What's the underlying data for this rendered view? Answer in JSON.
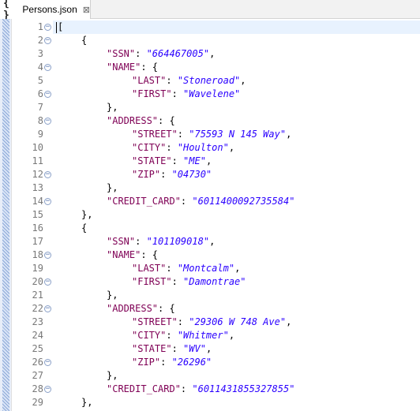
{
  "tab": {
    "icon": "json-braces-icon",
    "title": "Persons.json",
    "close": "⊠"
  },
  "editor": {
    "lines": [
      {
        "n": "1",
        "fold": true,
        "indent": 0,
        "text": "["
      },
      {
        "n": "2",
        "fold": true,
        "indent": 1,
        "text": "{"
      },
      {
        "n": "3",
        "fold": false,
        "indent": 2,
        "key": "\"SSN\"",
        "sep": ": ",
        "value": "\"664467005\"",
        "tail": ","
      },
      {
        "n": "4",
        "fold": true,
        "indent": 2,
        "key": "\"NAME\"",
        "sep": ": {",
        "value": "",
        "tail": ""
      },
      {
        "n": "5",
        "fold": false,
        "indent": 3,
        "key": "\"LAST\"",
        "sep": ": ",
        "value": "\"Stoneroad\"",
        "tail": ","
      },
      {
        "n": "6",
        "fold": true,
        "indent": 3,
        "key": "\"FIRST\"",
        "sep": ": ",
        "value": "\"Wavelene\"",
        "tail": ""
      },
      {
        "n": "7",
        "fold": false,
        "indent": 2,
        "text": "},"
      },
      {
        "n": "8",
        "fold": true,
        "indent": 2,
        "key": "\"ADDRESS\"",
        "sep": ": {",
        "value": "",
        "tail": ""
      },
      {
        "n": "9",
        "fold": false,
        "indent": 3,
        "key": "\"STREET\"",
        "sep": ": ",
        "value": "\"75593 N 145 Way\"",
        "tail": ","
      },
      {
        "n": "10",
        "fold": false,
        "indent": 3,
        "key": "\"CITY\"",
        "sep": ": ",
        "value": "\"Houlton\"",
        "tail": ","
      },
      {
        "n": "11",
        "fold": false,
        "indent": 3,
        "key": "\"STATE\"",
        "sep": ": ",
        "value": "\"ME\"",
        "tail": ","
      },
      {
        "n": "12",
        "fold": true,
        "indent": 3,
        "key": "\"ZIP\"",
        "sep": ": ",
        "value": "\"04730\"",
        "tail": ""
      },
      {
        "n": "13",
        "fold": false,
        "indent": 2,
        "text": "},"
      },
      {
        "n": "14",
        "fold": true,
        "indent": 2,
        "key": "\"CREDIT_CARD\"",
        "sep": ": ",
        "value": "\"6011400092735584\"",
        "tail": ""
      },
      {
        "n": "15",
        "fold": false,
        "indent": 1,
        "text": "},"
      },
      {
        "n": "16",
        "fold": false,
        "indent": 1,
        "text": "{"
      },
      {
        "n": "17",
        "fold": false,
        "indent": 2,
        "key": "\"SSN\"",
        "sep": ": ",
        "value": "\"101109018\"",
        "tail": ","
      },
      {
        "n": "18",
        "fold": true,
        "indent": 2,
        "key": "\"NAME\"",
        "sep": ": {",
        "value": "",
        "tail": ""
      },
      {
        "n": "19",
        "fold": false,
        "indent": 3,
        "key": "\"LAST\"",
        "sep": ": ",
        "value": "\"Montcalm\"",
        "tail": ","
      },
      {
        "n": "20",
        "fold": true,
        "indent": 3,
        "key": "\"FIRST\"",
        "sep": ": ",
        "value": "\"Damontrae\"",
        "tail": ""
      },
      {
        "n": "21",
        "fold": false,
        "indent": 2,
        "text": "},"
      },
      {
        "n": "22",
        "fold": true,
        "indent": 2,
        "key": "\"ADDRESS\"",
        "sep": ": {",
        "value": "",
        "tail": ""
      },
      {
        "n": "23",
        "fold": false,
        "indent": 3,
        "key": "\"STREET\"",
        "sep": ": ",
        "value": "\"29306 W 748 Ave\"",
        "tail": ","
      },
      {
        "n": "24",
        "fold": false,
        "indent": 3,
        "key": "\"CITY\"",
        "sep": ": ",
        "value": "\"Whitmer\"",
        "tail": ","
      },
      {
        "n": "25",
        "fold": false,
        "indent": 3,
        "key": "\"STATE\"",
        "sep": ": ",
        "value": "\"WV\"",
        "tail": ","
      },
      {
        "n": "26",
        "fold": true,
        "indent": 3,
        "key": "\"ZIP\"",
        "sep": ": ",
        "value": "\"26296\"",
        "tail": ""
      },
      {
        "n": "27",
        "fold": false,
        "indent": 2,
        "text": "},"
      },
      {
        "n": "28",
        "fold": true,
        "indent": 2,
        "key": "\"CREDIT_CARD\"",
        "sep": ": ",
        "value": "\"6011431855327855\"",
        "tail": ""
      },
      {
        "n": "29",
        "fold": false,
        "indent": 1,
        "text": "},"
      }
    ]
  }
}
